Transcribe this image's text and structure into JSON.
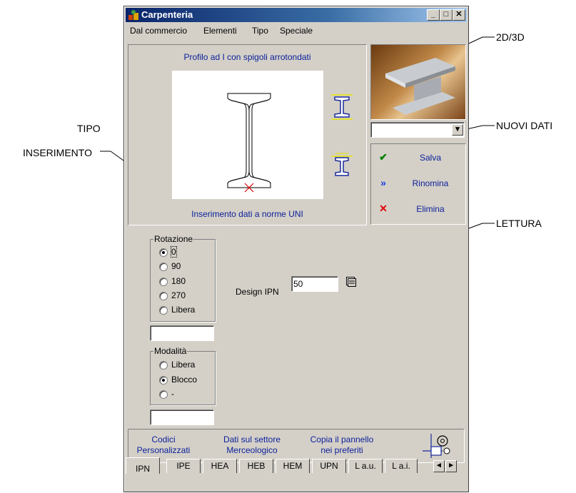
{
  "window": {
    "title": "Carpenteria",
    "app_icon": "carpenteria-app-icon"
  },
  "menu": [
    "Dal commercio",
    "Elementi",
    "Tipo",
    "Speciale"
  ],
  "profile": {
    "title": "Profilo ad I con spigoli arrotondati",
    "insertion_label": "Inserimento dati a norme UNI",
    "view_2d3d_icon": "ibeam-2d3d-icon",
    "new_data_icon": "ibeam-new-data-icon"
  },
  "actions": {
    "save": "Salva",
    "rename": "Rinomina",
    "delete": "Elimina"
  },
  "rotation": {
    "legend": "Rotazione",
    "options": [
      "0",
      "90",
      "180",
      "270",
      "Libera"
    ],
    "selected": "0",
    "field_value": ""
  },
  "mode": {
    "legend": "Modalità",
    "options": [
      "Libera",
      "Blocco",
      "-"
    ],
    "selected": "Blocco",
    "field_value": ""
  },
  "design": {
    "label": "Design IPN",
    "value": "50"
  },
  "bottom_buttons": {
    "custom_codes": [
      "Codici",
      "Personalizzati"
    ],
    "sector_data": [
      "Dati sul settore",
      "Merceologico"
    ],
    "copy_panel": [
      "Copia il pannello",
      "nei preferiti"
    ]
  },
  "tabs": [
    "IPN",
    "IPE",
    "HEA",
    "HEB",
    "HEM",
    "UPN",
    "L a.u.",
    "L a.i."
  ],
  "active_tab": "IPN",
  "callouts": {
    "view_2d3d": "2D/3D",
    "new_data": "NUOVI DATI",
    "insert_type_1": "TIPO",
    "insert_type_2": "INSERIMENTO",
    "reading": "LETTURA"
  },
  "colors": {
    "title_blue": "#0a246a",
    "label_blue": "#0a1e9a",
    "save_green": "#008000",
    "rename_blue": "#1a3adf",
    "delete_red": "#e00000"
  }
}
